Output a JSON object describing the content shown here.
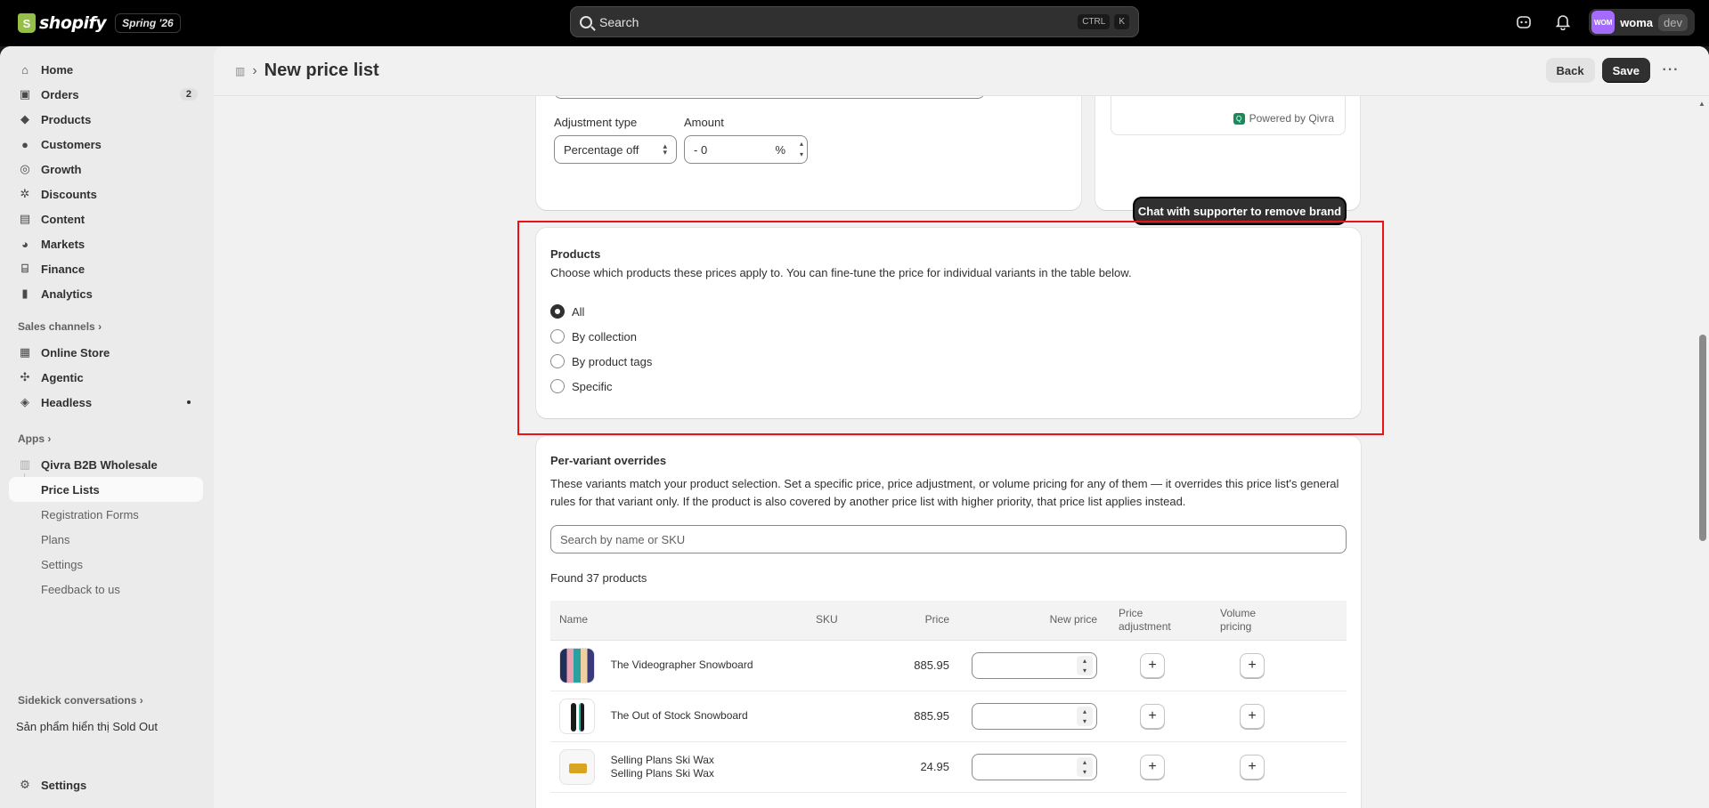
{
  "topbar": {
    "logo_text": "shopify",
    "edition": "Spring '26",
    "search_placeholder": "Search",
    "kbd1": "CTRL",
    "kbd2": "K",
    "store_initials": "WOM",
    "store_name": "woma",
    "store_tag": "dev"
  },
  "sidebar": {
    "home": "Home",
    "orders": "Orders",
    "orders_badge": "2",
    "products": "Products",
    "customers": "Customers",
    "growth": "Growth",
    "discounts": "Discounts",
    "content": "Content",
    "markets": "Markets",
    "finance": "Finance",
    "analytics": "Analytics",
    "sales_channels": "Sales channels",
    "online_store": "Online Store",
    "agentic": "Agentic",
    "headless": "Headless",
    "apps": "Apps",
    "app_name": "Qivra B2B Wholesale",
    "price_lists": "Price Lists",
    "registration_forms": "Registration Forms",
    "plans": "Plans",
    "app_settings": "Settings",
    "feedback": "Feedback to us",
    "sidekick": "Sidekick conversations",
    "sidekick_item": "Sản phẩm hiển thị Sold Out",
    "settings": "Settings"
  },
  "header": {
    "title": "New price list",
    "back_label": "Back",
    "save_label": "Save"
  },
  "adjustment": {
    "type_label": "Adjustment type",
    "type_value": "Percentage off",
    "amount_label": "Amount",
    "amount_value": "- 0",
    "amount_suffix": "%"
  },
  "preview": {
    "powered_by": "Powered by Qivra",
    "remove_brand_button": "Chat with supporter to remove brand"
  },
  "products_card": {
    "title": "Products",
    "description": "Choose which products these prices apply to. You can fine-tune the price for individual variants in the table below.",
    "options": [
      "All",
      "By collection",
      "By product tags",
      "Specific"
    ],
    "selected": "All"
  },
  "overrides": {
    "title": "Per-variant overrides",
    "description": "These variants match your product selection. Set a specific price, price adjustment, or volume pricing for any of them — it overrides this price list's general rules for that variant only. If the product is also covered by another price list with higher priority, that price list applies instead.",
    "search_placeholder": "Search by name or SKU",
    "found": "Found 37 products",
    "columns": {
      "name": "Name",
      "sku": "SKU",
      "price": "Price",
      "new_price": "New price",
      "price_adjustment": "Price adjustment",
      "volume_pricing": "Volume pricing"
    },
    "rows": [
      {
        "name": "The Videographer Snowboard",
        "variant": "",
        "sku": "",
        "price": "885.95"
      },
      {
        "name": "The Out of Stock Snowboard",
        "variant": "",
        "sku": "",
        "price": "885.95"
      },
      {
        "name": "Selling Plans Ski Wax",
        "variant": "Selling Plans Ski Wax",
        "sku": "",
        "price": "24.95"
      }
    ]
  },
  "colors": {
    "highlight": "#ee1111",
    "primary": "#303030",
    "accent_avatar": "#a56bff"
  }
}
